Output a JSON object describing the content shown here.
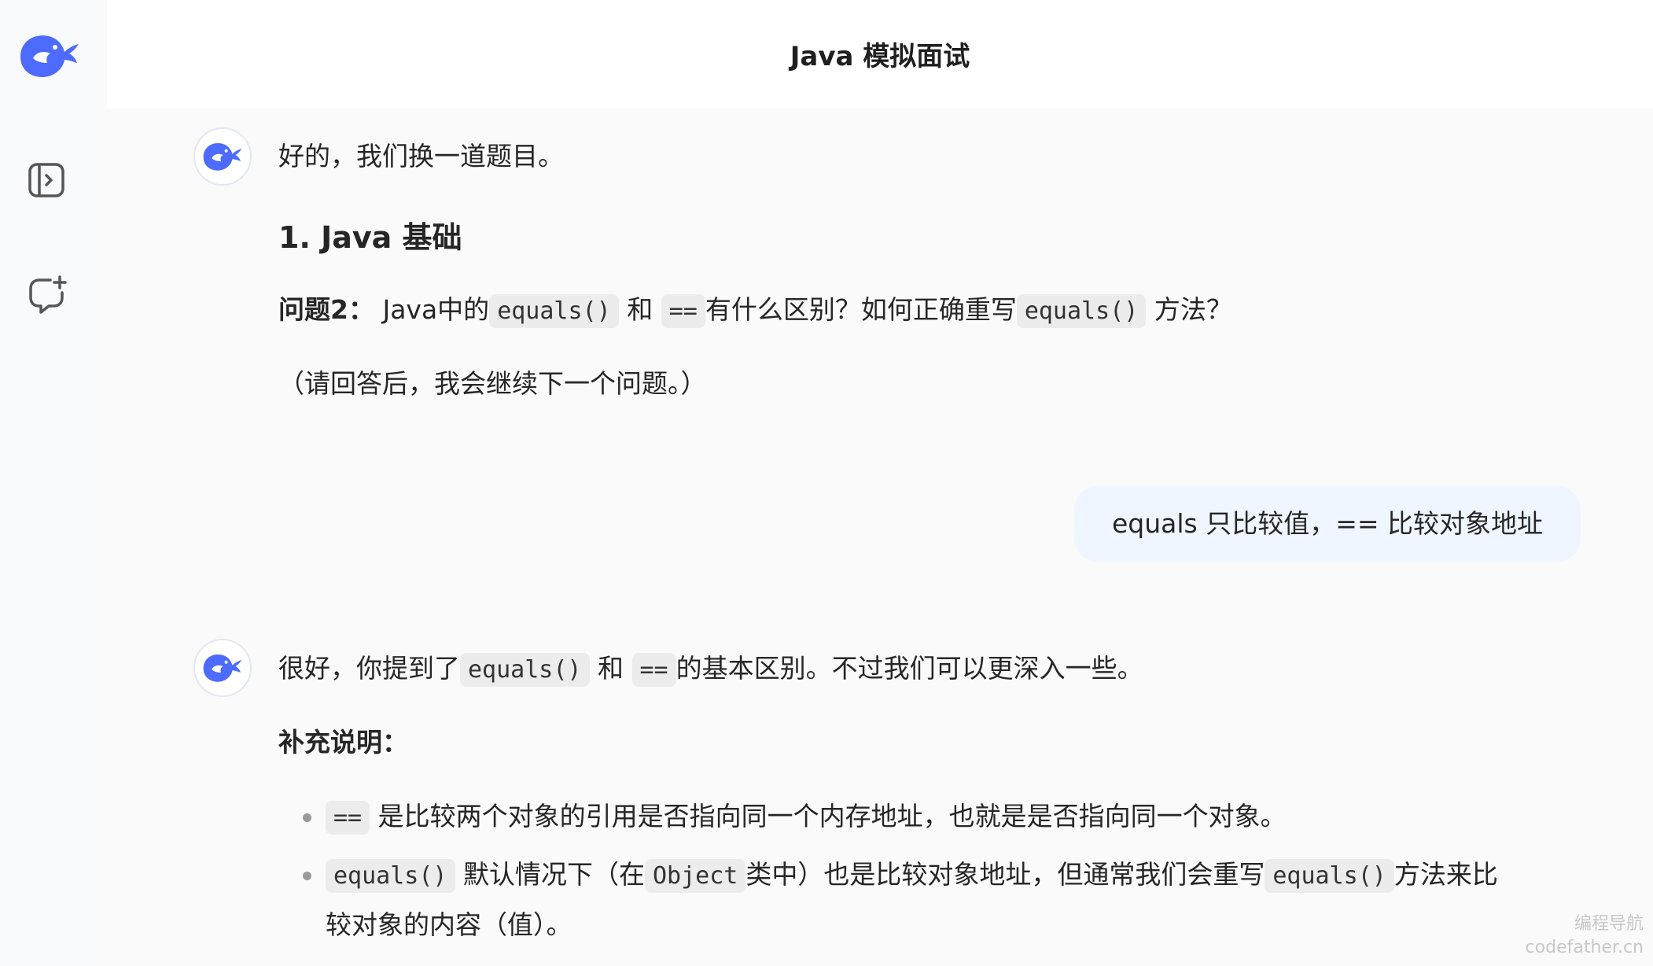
{
  "header": {
    "title": "Java 模拟面试"
  },
  "sidebar": {
    "items": [
      {
        "icon": "deepseek-whale-logo"
      },
      {
        "icon": "sidebar-toggle-icon"
      },
      {
        "icon": "new-chat-icon"
      }
    ]
  },
  "messages": {
    "m1": {
      "intro": "好的，我们换一道题目。",
      "heading": "1. Java 基础",
      "q_label": "问题2：",
      "q_t1": "Java中的",
      "q_code1": "equals()",
      "q_t2": "和",
      "q_code2": "==",
      "q_t3": "有什么区别？如何正确重写",
      "q_code3": "equals()",
      "q_t4": "方法？",
      "note": "（请回答后，我会继续下一个问题。）"
    },
    "user": {
      "text": "equals 只比较值，== 比较对象地址"
    },
    "m2": {
      "p_t1": "很好，你提到了",
      "p_code1": "equals()",
      "p_t2": "和",
      "p_code2": "==",
      "p_t3": "的基本区别。不过我们可以更深入一些。",
      "sub": "补充说明：",
      "b1_code": "==",
      "b1_text": "是比较两个对象的引用是否指向同一个内存地址，也就是是否指向同一个对象。",
      "b2_code1": "equals()",
      "b2_t1": "默认情况下（在",
      "b2_code2": "Object",
      "b2_t2": "类中）也是比较对象地址，但通常我们会重写",
      "b2_code3": "equals()",
      "b2_t3": "方法来比",
      "b2_line2": "较对象的内容（值）。"
    }
  },
  "watermark": {
    "line1": "编程导航",
    "line2": "codefather.cn"
  },
  "colors": {
    "accent": "#4d6bfe",
    "bubble": "#eff6ff",
    "code_bg": "#ececec"
  }
}
